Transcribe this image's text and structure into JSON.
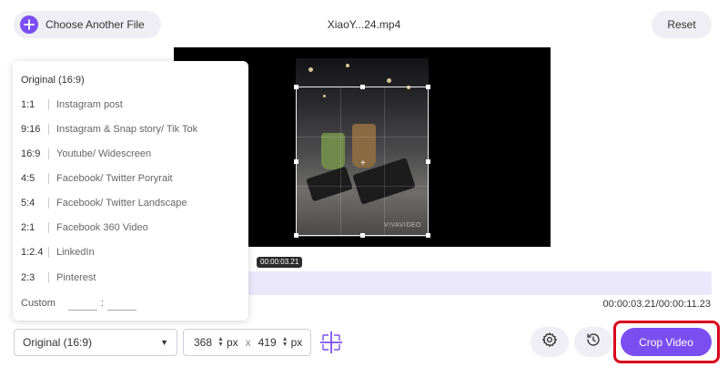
{
  "header": {
    "choose_file_label": "Choose Another File",
    "file_name": "XiaoY...24.mp4",
    "reset_label": "Reset"
  },
  "preview": {
    "watermark": "VIVAVIDEO"
  },
  "timeline": {
    "current_badge": "00:00:03.21",
    "time_readout": "00:00:03.21/00:00:11.23",
    "progress_fraction": 0.286
  },
  "ratio_panel": {
    "original": "Original (16:9)",
    "items": [
      {
        "ratio": "1:1",
        "desc": "Instagram post"
      },
      {
        "ratio": "9:16",
        "desc": "Instagram & Snap story/ Tik Tok"
      },
      {
        "ratio": "16:9",
        "desc": "Youtube/ Widescreen"
      },
      {
        "ratio": "4:5",
        "desc": "Facebook/ Twitter Poryrait"
      },
      {
        "ratio": "5:4",
        "desc": "Facebook/ Twitter Landscape"
      },
      {
        "ratio": "2:1",
        "desc": "Facebook 360 Video"
      },
      {
        "ratio": "1:2.4",
        "desc": "LinkedIn"
      },
      {
        "ratio": "2:3",
        "desc": "Pinterest"
      }
    ],
    "custom_label": "Custom",
    "custom_separator": ":"
  },
  "controls": {
    "ratio_selected": "Original (16:9)",
    "width_value": "368",
    "height_value": "419",
    "unit": "px",
    "times_symbol": "x",
    "crop_video_label": "Crop Video"
  },
  "colors": {
    "accent": "#7b4ef2",
    "highlight": "#d9001b",
    "playhead": "#f5a84a"
  },
  "icons": [
    "plus-icon",
    "settings-gear-icon",
    "history-icon",
    "crop-center-icon",
    "dropdown-caret-icon"
  ]
}
